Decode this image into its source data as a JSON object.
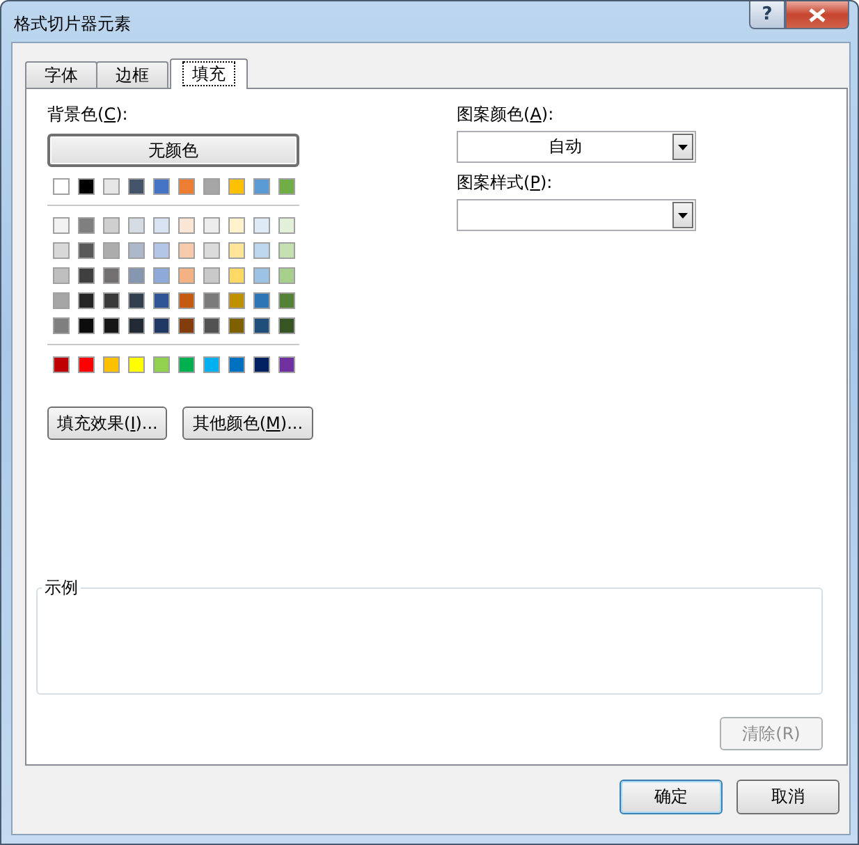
{
  "window": {
    "title": "格式切片器元素",
    "help_button": "?"
  },
  "tabs": [
    {
      "label": "字体",
      "selected": false
    },
    {
      "label": "边框",
      "selected": false
    },
    {
      "label": "填充",
      "selected": true
    }
  ],
  "background_color": {
    "label": [
      "背景色(",
      "C",
      "):"
    ],
    "no_color_button": "无颜色",
    "theme_colors": [
      {
        "color": "#ffffff"
      },
      {
        "color": "#000000"
      },
      {
        "color": "#e7e6e6"
      },
      {
        "color": "#44546a"
      },
      {
        "color": "#4472c4"
      },
      {
        "color": "#ed7d31"
      },
      {
        "color": "#a5a5a5"
      },
      {
        "color": "#ffc000"
      },
      {
        "color": "#5b9bd5"
      },
      {
        "color": "#70ad47"
      }
    ],
    "shade_rows": [
      [
        {
          "color": "#f2f2f2"
        },
        {
          "color": "#7f7f7f"
        },
        {
          "color": "#d0cece"
        },
        {
          "color": "#d6dce4"
        },
        {
          "color": "#d9e2f3"
        },
        {
          "color": "#fbe5d5"
        },
        {
          "color": "#ededed"
        },
        {
          "color": "#fff2cc"
        },
        {
          "color": "#deebf6"
        },
        {
          "color": "#e2efd9"
        }
      ],
      [
        {
          "color": "#d8d8d8"
        },
        {
          "color": "#595959"
        },
        {
          "color": "#aeabab"
        },
        {
          "color": "#adb9ca"
        },
        {
          "color": "#b4c6e7"
        },
        {
          "color": "#f7cbac"
        },
        {
          "color": "#dbdbdb"
        },
        {
          "color": "#fee599"
        },
        {
          "color": "#bdd7ee"
        },
        {
          "color": "#c5e0b3"
        }
      ],
      [
        {
          "color": "#bfbfbf"
        },
        {
          "color": "#3f3f3f"
        },
        {
          "color": "#757070"
        },
        {
          "color": "#8496b0"
        },
        {
          "color": "#8eaadb"
        },
        {
          "color": "#f4b183"
        },
        {
          "color": "#c9c9c9"
        },
        {
          "color": "#ffd965"
        },
        {
          "color": "#9cc3e5"
        },
        {
          "color": "#a8d08d"
        }
      ],
      [
        {
          "color": "#a5a5a5"
        },
        {
          "color": "#262626"
        },
        {
          "color": "#3a3838"
        },
        {
          "color": "#323f4f"
        },
        {
          "color": "#2f5496"
        },
        {
          "color": "#c55a11"
        },
        {
          "color": "#7b7b7b"
        },
        {
          "color": "#bf9000"
        },
        {
          "color": "#2e75b5"
        },
        {
          "color": "#538135"
        }
      ],
      [
        {
          "color": "#7f7f7f"
        },
        {
          "color": "#0c0c0c"
        },
        {
          "color": "#171616"
        },
        {
          "color": "#222a35"
        },
        {
          "color": "#1f3864"
        },
        {
          "color": "#833c0b"
        },
        {
          "color": "#525252"
        },
        {
          "color": "#7f6000"
        },
        {
          "color": "#1e4e79"
        },
        {
          "color": "#375623"
        }
      ]
    ],
    "standard_colors": [
      {
        "color": "#c00000"
      },
      {
        "color": "#ff0000"
      },
      {
        "color": "#ffc000"
      },
      {
        "color": "#ffff00"
      },
      {
        "color": "#92d050"
      },
      {
        "color": "#00b050"
      },
      {
        "color": "#00b0f0"
      },
      {
        "color": "#0070c0"
      },
      {
        "color": "#002060"
      },
      {
        "color": "#7030a0"
      }
    ],
    "buttons": [
      [
        "填充效果(",
        "I",
        ")..."
      ],
      [
        "其他颜色(",
        "M",
        ")..."
      ]
    ]
  },
  "pattern_color": {
    "label": [
      "图案颜色(",
      "A",
      "):"
    ],
    "value": "自动"
  },
  "pattern_style": {
    "label": [
      "图案样式(",
      "P",
      "):"
    ]
  },
  "sample": {
    "label": "示例"
  },
  "clear_button": {
    "label": "清除(R)",
    "disabled": true
  },
  "dialog_buttons": [
    {
      "label": "确定",
      "default": true
    },
    {
      "label": "取消",
      "default": false
    }
  ]
}
